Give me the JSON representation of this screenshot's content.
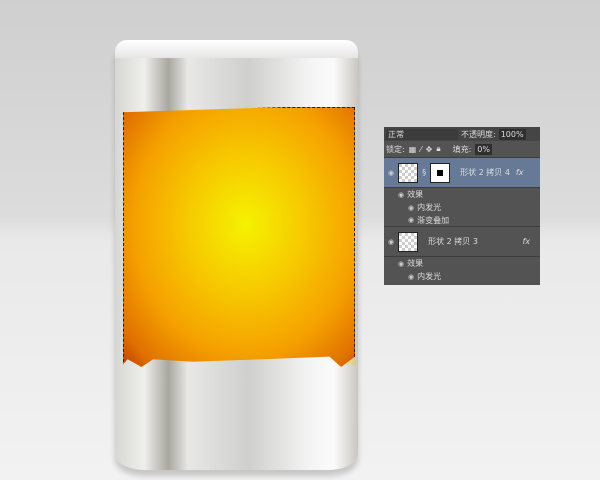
{
  "layers_panel": {
    "blend_mode": "正常",
    "opacity_label": "不透明度:",
    "opacity_value": "100%",
    "lock_label": "锁定:",
    "fill_label": "填充:",
    "fill_value": "0%",
    "layers": [
      {
        "name": "形状 2 拷贝 4",
        "fx": "fx",
        "effects_label": "效果",
        "effects": [
          "内发光",
          "渐变叠加"
        ]
      },
      {
        "name": "形状 2 拷贝 3",
        "fx": "fx",
        "effects_label": "效果",
        "effects": [
          "内发光"
        ]
      }
    ]
  }
}
